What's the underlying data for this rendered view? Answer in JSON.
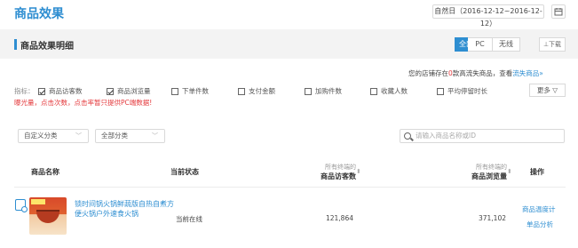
{
  "header": {
    "title": "商品效果",
    "date_range": "自然日（2016-12-12~2016-12-12）"
  },
  "section": {
    "title": "商品效果明细",
    "tabs": [
      "全部",
      "PC",
      "无线"
    ],
    "active_tab": "全部",
    "download_label": "⊥下载"
  },
  "notice": {
    "prefix": "您的店铺存在",
    "count": "0",
    "middle": "款高流失商品，查看",
    "link": "流失商品»"
  },
  "indicators": {
    "label": "指标：",
    "items": [
      {
        "label": "商品访客数",
        "checked": true
      },
      {
        "label": "商品浏览量",
        "checked": true
      },
      {
        "label": "下单件数",
        "checked": false
      },
      {
        "label": "支付金额",
        "checked": false
      },
      {
        "label": "加购件数",
        "checked": false
      },
      {
        "label": "收藏人数",
        "checked": false
      },
      {
        "label": "平均停留时长",
        "checked": false
      }
    ],
    "more_label": "更多 ▽",
    "warning": "曝光量，点击次数，点击率暂只提供PC端数据!"
  },
  "filters": {
    "custom_category": "自定义分类",
    "all_category": "全部分类",
    "search_placeholder": "请输入商品名称或ID"
  },
  "table": {
    "columns": {
      "name": "商品名称",
      "status": "当前状态",
      "visitors_sub": "所有终端的",
      "visitors": "商品访客数",
      "pageviews_sub": "所有终端的",
      "pageviews": "商品浏览量",
      "actions": "操作"
    },
    "rows": [
      {
        "name": "锁时间锅火锅鲜蔬版自热自煮方便火锅户外速食火锅",
        "status": "当前在线",
        "visitors": "121,864",
        "pageviews": "371,102",
        "action_1": "商品温度计",
        "action_2": "单品分析"
      }
    ]
  },
  "colors": {
    "accent": "#2e8ed1",
    "warning": "#e4393c"
  }
}
